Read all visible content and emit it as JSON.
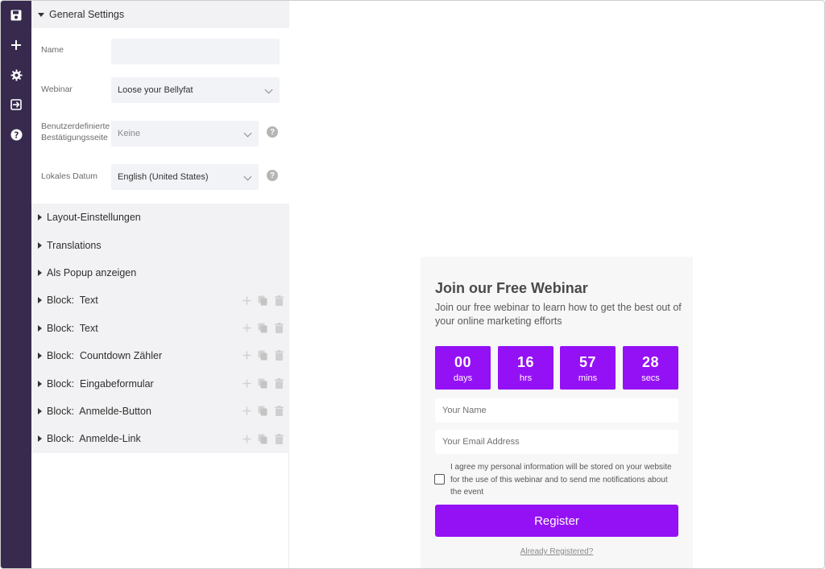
{
  "rail": {
    "items": [
      {
        "icon": "save-icon"
      },
      {
        "icon": "plus-icon"
      },
      {
        "icon": "gear-icon"
      },
      {
        "icon": "sign-in-icon"
      },
      {
        "icon": "help-icon"
      }
    ]
  },
  "panel": {
    "general_title": "General Settings",
    "fields": {
      "name_label": "Name",
      "name_value": "",
      "webinar_label": "Webinar",
      "webinar_value": "Loose your Bellyfat",
      "confirm_label": "Benutzerdefinierte Bestätigungsseite",
      "confirm_value": "Keine",
      "locale_label": "Lokales Datum",
      "locale_value": "English (United States)",
      "help_glyph": "?"
    },
    "sections": [
      {
        "label": "Layout-Einstellungen",
        "tools": false
      },
      {
        "label": "Translations",
        "tools": false
      },
      {
        "label": "Als Popup anzeigen",
        "tools": false
      },
      {
        "label": "Block:  Text",
        "tools": true
      },
      {
        "label": "Block:  Text",
        "tools": true
      },
      {
        "label": "Block:  Countdown Zähler",
        "tools": true
      },
      {
        "label": "Block:  Eingabeformular",
        "tools": true
      },
      {
        "label": "Block:  Anmelde-Button",
        "tools": true
      },
      {
        "label": "Block:  Anmelde-Link",
        "tools": true
      }
    ]
  },
  "preview": {
    "title": "Join our Free Webinar",
    "subtitle": "Join our free webinar to learn how to get the best out of your online marketing efforts",
    "countdown": [
      {
        "value": "00",
        "unit": "days"
      },
      {
        "value": "16",
        "unit": "hrs"
      },
      {
        "value": "57",
        "unit": "mins"
      },
      {
        "value": "28",
        "unit": "secs"
      }
    ],
    "name_placeholder": "Your Name",
    "email_placeholder": "Your Email Address",
    "consent_text": "I agree my personal information will be stored on your website for the use of this webinar and to send me notifications about the event",
    "consent_checked": false,
    "register_label": "Register",
    "already_label": "Already Registered?"
  },
  "colors": {
    "rail_bg": "#372a4e",
    "accent": "#9511f5",
    "panel_section_bg": "#f2f2f4",
    "field_bg": "#f2f3f7"
  }
}
